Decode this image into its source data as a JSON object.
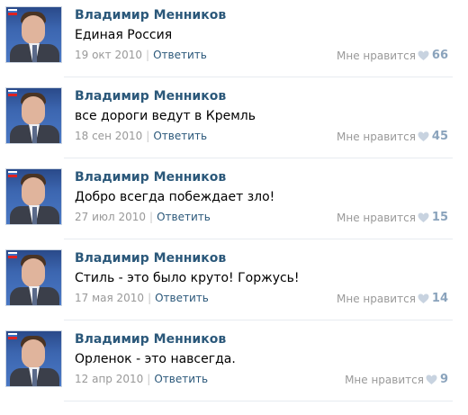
{
  "colors": {
    "author": "#2b587a",
    "link": "#2b587a",
    "meta": "#999999",
    "like_count": "#8aa3bc",
    "separator": "#e7ebf0"
  },
  "comments": [
    {
      "author": "Владимир Менников",
      "text": "Единая Россия",
      "date": "19 окт 2010",
      "reply_label": "Ответить",
      "like_label": "Мне нравится",
      "like_icon": "heart-icon",
      "likes": "66"
    },
    {
      "author": "Владимир Менников",
      "text": "все дороги ведут в Кремль",
      "date": "18 сен 2010",
      "reply_label": "Ответить",
      "like_label": "Мне нравится",
      "like_icon": "heart-icon",
      "likes": "45"
    },
    {
      "author": "Владимир Менников",
      "text": "Добро всегда побеждает зло!",
      "date": "27 июл 2010",
      "reply_label": "Ответить",
      "like_label": "Мне нравится",
      "like_icon": "heart-icon",
      "likes": "15"
    },
    {
      "author": "Владимир Менников",
      "text": "Стиль - это было круто! Горжусь!",
      "date": "17 мая 2010",
      "reply_label": "Ответить",
      "like_label": "Мне нравится",
      "like_icon": "heart-icon",
      "likes": "14"
    },
    {
      "author": "Владимир Менников",
      "text": "Орленок - это навсегда.",
      "date": "12 апр 2010",
      "reply_label": "Ответить",
      "like_label": "Мне нравится",
      "like_icon": "heart-icon",
      "likes": "9"
    }
  ]
}
